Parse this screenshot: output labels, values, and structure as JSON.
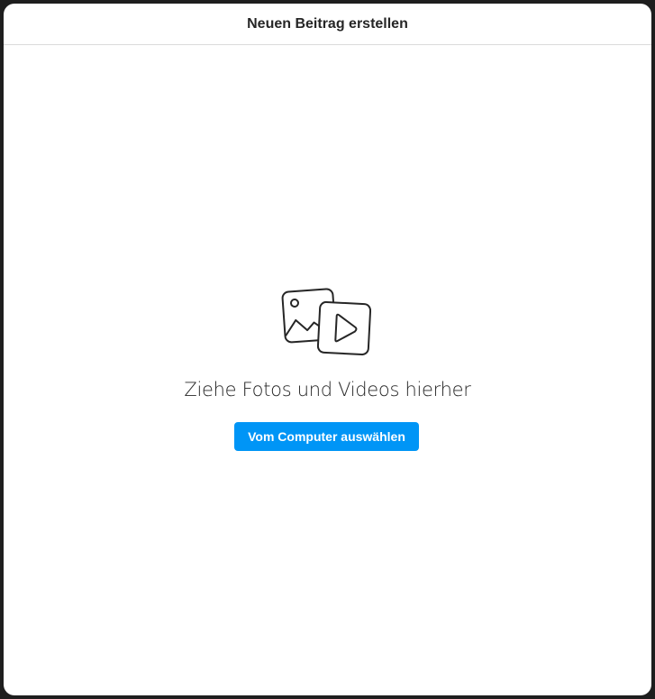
{
  "modal": {
    "title": "Neuen Beitrag erstellen"
  },
  "dropzone": {
    "icon": "photo-video-icon",
    "text": "Ziehe Fotos und Videos hierher",
    "button_label": "Vom Computer auswählen"
  },
  "colors": {
    "accent": "#0095f6",
    "text": "#262626",
    "divider": "#dbdbdb",
    "backdrop": "#1e1e1e"
  }
}
